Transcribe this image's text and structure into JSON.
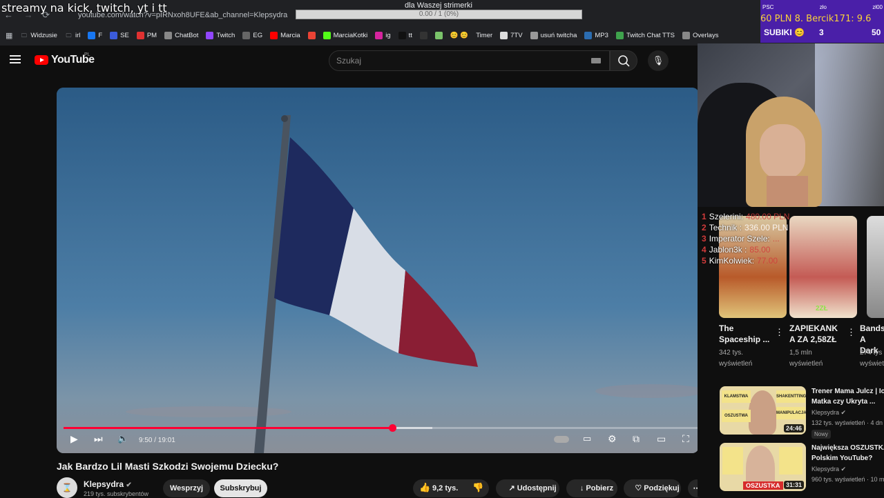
{
  "overlay": {
    "title": "streamy na kick, twitch, yt i tt"
  },
  "browser": {
    "url": "youtube.com/watch?v=pIRNxoh8UFE&ab_channel=Klepsydra",
    "bookmarks": [
      {
        "label": "Widzusie",
        "icon": "folder-icon"
      },
      {
        "label": "irl",
        "icon": "folder-icon"
      },
      {
        "label": "F",
        "icon": "facebook-icon"
      },
      {
        "label": "SE",
        "icon": "anchor-icon"
      },
      {
        "label": "PM",
        "icon": "pm-icon"
      },
      {
        "label": "ChatBot",
        "icon": "chatbot-icon"
      },
      {
        "label": "Twitch",
        "icon": "twitch-icon"
      },
      {
        "label": "EG",
        "icon": "eg-icon"
      },
      {
        "label": "Marcia",
        "icon": "youtube-icon"
      },
      {
        "label": "",
        "icon": "gmail-icon"
      },
      {
        "label": "MarciaKotki",
        "icon": "kick-icon"
      },
      {
        "label": "ig",
        "icon": "instagram-icon"
      },
      {
        "label": "tt",
        "icon": "tiktok-icon"
      },
      {
        "label": "",
        "icon": "app-icon"
      },
      {
        "label": "",
        "icon": "image-icon"
      },
      {
        "label": "😊 😊",
        "icon": ""
      },
      {
        "label": "Timer",
        "icon": ""
      },
      {
        "label": "7TV",
        "icon": "7tv-icon"
      },
      {
        "label": "usuń twitcha",
        "icon": "pin-icon"
      },
      {
        "label": "MP3",
        "icon": "mp3-icon"
      },
      {
        "label": "Twitch Chat TTS",
        "icon": "tts-icon"
      },
      {
        "label": "Overlays",
        "icon": "globe-icon"
      }
    ]
  },
  "goal": {
    "title": "dla Waszej strimerki",
    "progress_text": "0.00 / 1 (0%)"
  },
  "donations": {
    "header": [
      "PSC",
      "zło",
      "zł00"
    ],
    "ticker": "60 PLN   8. Bercik171: 9.6",
    "subs_label": "SUBIKI 😊",
    "subs_count": "3",
    "subs_goal": "50"
  },
  "youtube": {
    "logo": "YouTube",
    "region": "PL",
    "search_placeholder": "Szukaj"
  },
  "player": {
    "time": "9:50 / 19:01",
    "progress_fraction": 0.517,
    "buffered_fraction": 0.58
  },
  "video": {
    "title": "Jak Bardzo Lil Masti Szkodzi Swojemu Dziecku?",
    "channel": "Klepsydra",
    "subscribers": "219 tys. subskrybentów",
    "support_label": "Wesprzyj",
    "subscribe_label": "Subskrybuj",
    "likes": "9,2 tys.",
    "share_label": "Udostępnij",
    "download_label": "Pobierz",
    "thanks_label": "Podziękuj"
  },
  "ranking": [
    {
      "rank": "1",
      "name": "Szelerini:",
      "amount": "480.00 PLN"
    },
    {
      "rank": "2",
      "name": "Technik :",
      "amount": "336.00 PLN"
    },
    {
      "rank": "3",
      "name": "Imperator Szele:",
      "amount": "..."
    },
    {
      "rank": "4",
      "name": "Jablon3k :",
      "amount": "85.00"
    },
    {
      "rank": "5",
      "name": "KimKolwiek:",
      "amount": "77.00"
    }
  ],
  "shorts": [
    {
      "title": [
        "The",
        "Spaceship ..."
      ],
      "views": [
        "342 tys.",
        "wyświetleń"
      ]
    },
    {
      "title": [
        "ZAPIEKANK",
        "A ZA 2,58ZŁ"
      ],
      "views": [
        "1,5 mln",
        "wyświetleń"
      ]
    },
    {
      "title": [
        "Bands",
        "A Dark"
      ],
      "views": [
        "274 tys",
        "wyświetl"
      ]
    }
  ],
  "recommended": [
    {
      "title": [
        "Trener Mama Julcz | Ic",
        "Matka czy Ukryta ..."
      ],
      "channel": "Klepsydra",
      "meta": "132 tys. wyświetleń · 4 dn",
      "badge": "Nowy",
      "duration": "24:46",
      "stickers": [
        "KLAMSTWA",
        "SHAKENTTING",
        "OSZUSTWA",
        "MANIPULACJA"
      ]
    },
    {
      "title": [
        "Największa OSZUSTKA",
        "Polskim YouTube?"
      ],
      "channel": "Klepsydra",
      "meta": "960 tys. wyświetleń · 10 m",
      "badge": "",
      "duration": "31:31",
      "stickers": [
        "OSZUSTKA"
      ]
    }
  ],
  "colors": {
    "accent": "#ff0033",
    "donation_bg": "#4a1fa8",
    "ticker": "#f9d23a"
  }
}
